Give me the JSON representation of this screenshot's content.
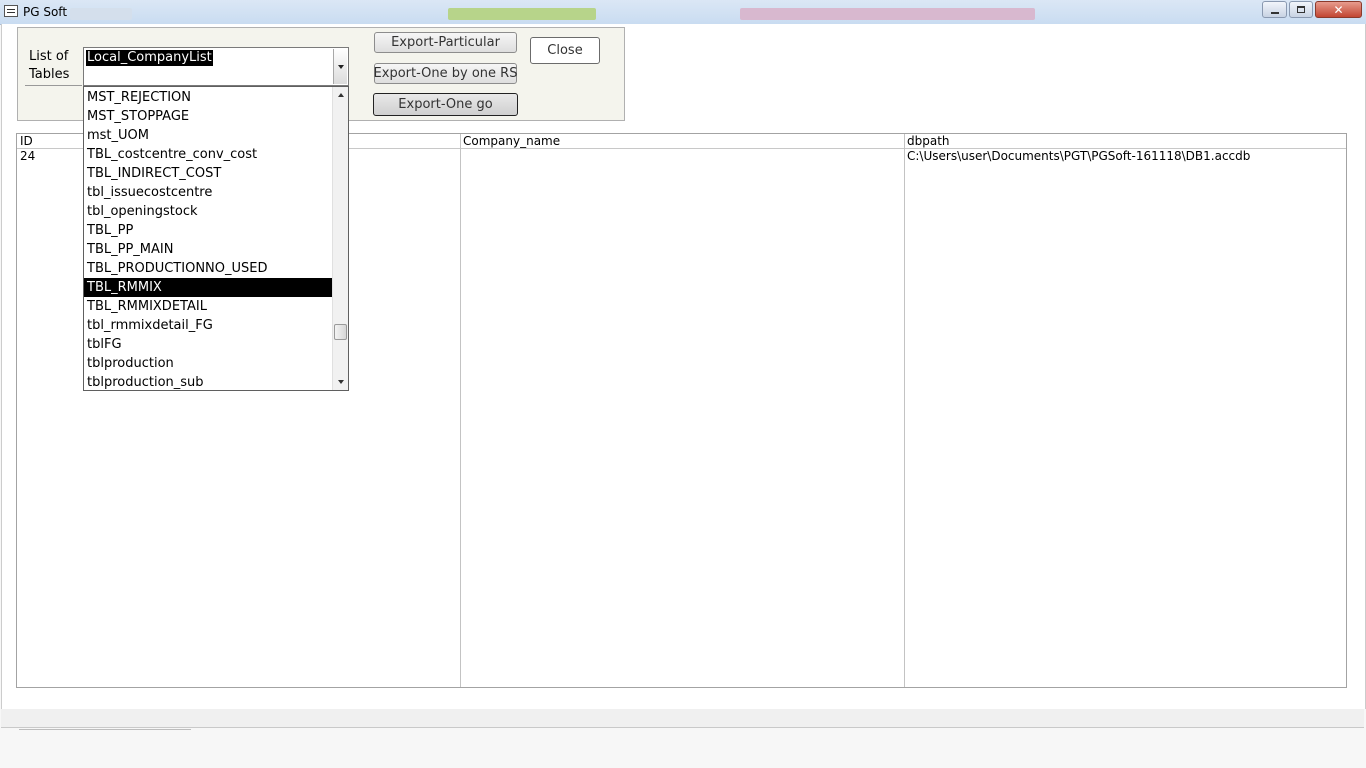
{
  "window": {
    "title": "PG Soft",
    "controls": {
      "minimize": "minimize-icon",
      "maximize": "maximize-icon",
      "close": "✕"
    }
  },
  "form": {
    "list_label": "List of Tables",
    "combo": {
      "value": "Local_CompanyList",
      "items": [
        "MST_REJECTION",
        "MST_STOPPAGE",
        "mst_UOM",
        "TBL_costcentre_conv_cost",
        "TBL_INDIRECT_COST",
        "tbl_issuecostcentre",
        "tbl_openingstock",
        "TBL_PP",
        "TBL_PP_MAIN",
        "TBL_PRODUCTIONNO_USED",
        "TBL_RMMIX",
        "TBL_RMMIXDETAIL",
        "tbl_rmmixdetail_FG",
        "tblFG",
        "tblproduction",
        "tblproduction_sub"
      ],
      "selected_item": "TBL_RMMIX"
    },
    "buttons": {
      "export_particular": "Export-Particular",
      "export_one_by_one": "Export-One by one RS",
      "export_one_go": "Export-One go",
      "close": "Close"
    }
  },
  "grid": {
    "columns": [
      "ID",
      "Company_name",
      "dbpath"
    ],
    "rows": [
      {
        "id": "24",
        "company_name": "",
        "dbpath": "C:\\Users\\user\\Documents\\PGT\\PGSoft-161118\\DB1.accdb"
      }
    ]
  },
  "colors": {
    "titlebar": "#c9dcf1",
    "panel": "#f4f4ed",
    "selection": "#000000",
    "close_button": "#c24632"
  }
}
